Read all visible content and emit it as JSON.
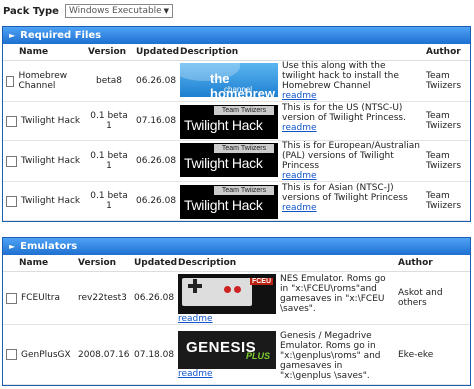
{
  "pack_type": {
    "label": "Pack Type",
    "selected": "Windows Executable"
  },
  "headers": {
    "name": "Name",
    "version": "Version",
    "updated": "Updated",
    "description": "Description",
    "author": "Author"
  },
  "required": {
    "title": "Required Files",
    "rows": [
      {
        "name": "Homebrew Channel",
        "version": "beta8",
        "updated": "06.26.08",
        "desc": "Use this along with the twilight hack to install the Homebrew Channel",
        "readme": "readme",
        "author": "Team Twiizers",
        "thumb_text": [
          "the homebrew",
          "channel"
        ]
      },
      {
        "name": "Twilight Hack",
        "version": "0.1 beta 1",
        "updated": "07.16.08",
        "desc": "This is for the US (NTSC-U) version of Twilight Princess.",
        "readme": "readme",
        "author": "Team Twiizers",
        "thumb_text": [
          "Team Twiizers",
          "Twilight Hack"
        ]
      },
      {
        "name": "Twilight Hack",
        "version": "0.1 beta 1",
        "updated": "06.26.08",
        "desc": "This is for European/Australian (PAL) versions of Twilight Princess",
        "readme": "readme",
        "author": "Team Twiizers",
        "thumb_text": [
          "Team Twiizers",
          "Twilight Hack"
        ]
      },
      {
        "name": "Twilight Hack",
        "version": "0.1 beta 1",
        "updated": "06.26.08",
        "desc": "This is for Asian (NTSC-J) versions of Twilight Princess",
        "readme": "readme",
        "author": "Team Twiizers",
        "thumb_text": [
          "Team Twiizers",
          "Twilight Hack"
        ]
      }
    ]
  },
  "emulators": {
    "title": "Emulators",
    "rows": [
      {
        "name": "FCEUltra",
        "version": "rev22test3",
        "updated": "06.26.08",
        "desc": "NES Emulator. Roms go in \"x:\\FCEU\\roms\"and gamesaves in \"x:\\FCEU \\saves\".",
        "readme": "readme",
        "author": "Askot and others",
        "thumb_text": [
          "FCEU"
        ]
      },
      {
        "name": "GenPlusGX",
        "version": "2008.07.16",
        "updated": "07.18.08",
        "desc": "Genesis / Megadrive Emulator. Roms go in \"x:\\genplus\\roms\" and gamesaves in \"x:\\genplus \\saves\".",
        "readme": "readme",
        "author": "Eke-eke",
        "thumb_text": [
          "GENESIS",
          "PLUS"
        ]
      }
    ]
  }
}
